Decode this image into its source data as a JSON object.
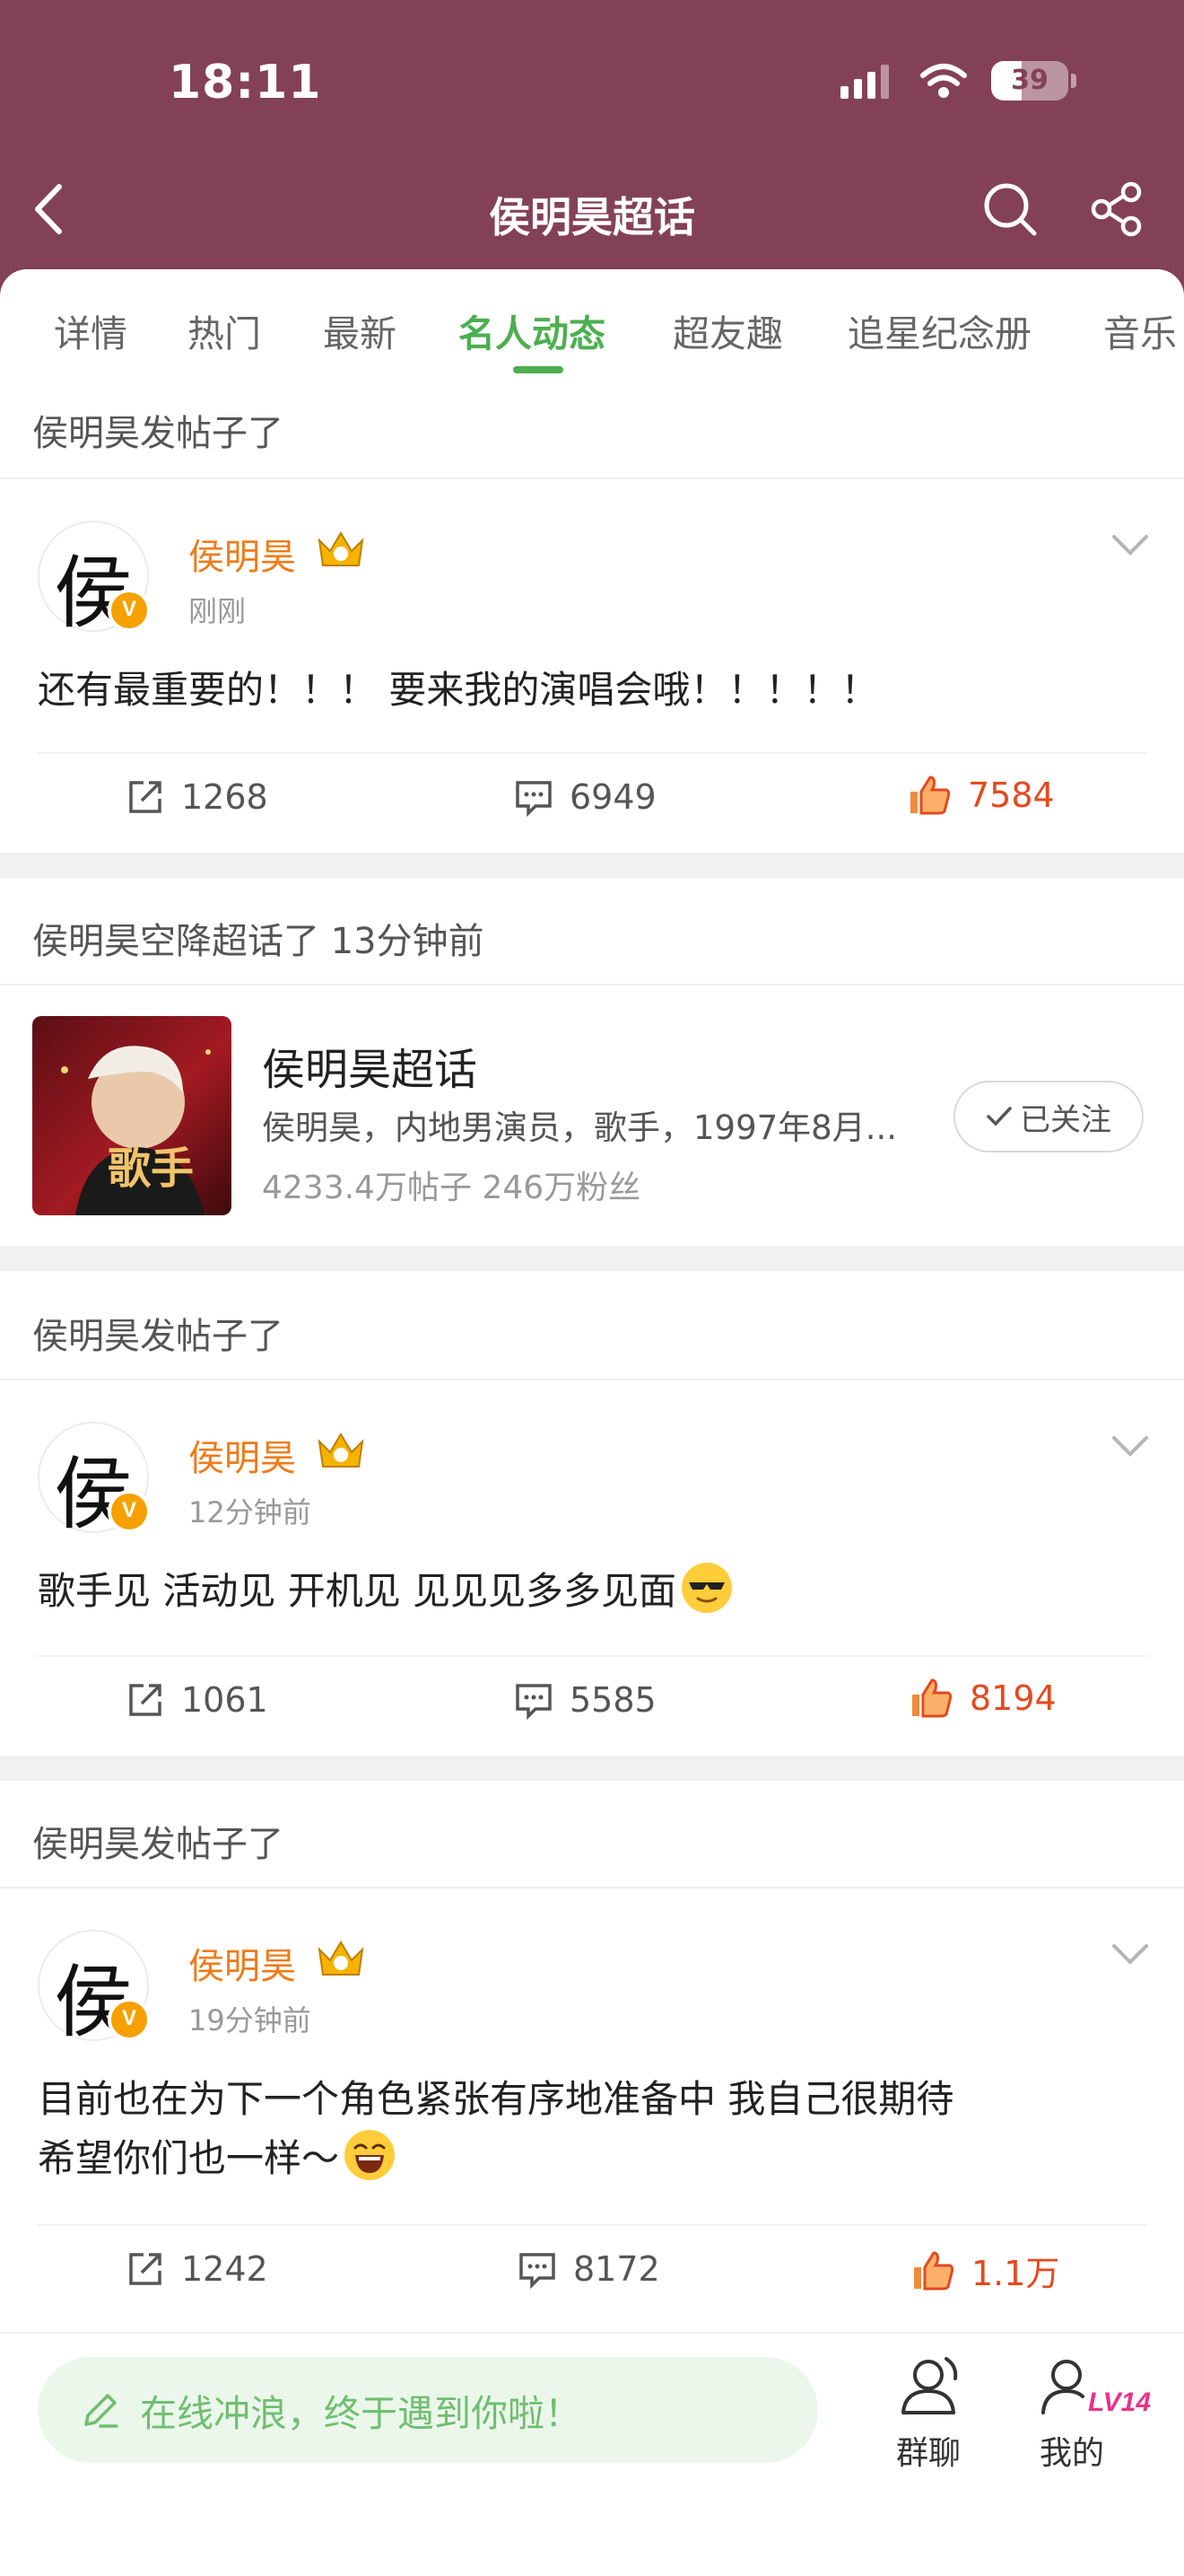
{
  "status_bar": {
    "time": "18:11",
    "battery": "39",
    "battery_level": 0.39
  },
  "nav": {
    "title": "侯明昊超话"
  },
  "tabs": [
    {
      "label": "详情"
    },
    {
      "label": "热门"
    },
    {
      "label": "最新"
    },
    {
      "label": "名人动态"
    },
    {
      "label": "超友趣"
    },
    {
      "label": "追星纪念册"
    },
    {
      "label": "音乐"
    }
  ],
  "active_tab": "名人动态",
  "feed": {
    "post1": {
      "header": "侯明昊发帖子了",
      "avatar_char": "侯",
      "badge": "V",
      "user": "侯明昊",
      "time": "刚刚",
      "text": "还有最重要的！！！ 要来我的演唱会哦！！！！！",
      "reposts": "1268",
      "comments": "6949",
      "likes": "7584"
    },
    "topic": {
      "header": "侯明昊空降超话了 13分钟前",
      "thumb_text": "歌手",
      "name": "侯明昊超话",
      "desc": "侯明昊，内地男演员，歌手，1997年8月...",
      "stats": "4233.4万帖子  246万粉丝",
      "follow_label": "已关注"
    },
    "post2": {
      "header": "侯明昊发帖子了",
      "avatar_char": "侯",
      "badge": "V",
      "user": "侯明昊",
      "time": "12分钟前",
      "text": "歌手见  活动见  开机见  见见见多多见面",
      "emoji": "cool-face-emoji",
      "reposts": "1061",
      "comments": "5585",
      "likes": "8194"
    },
    "post3": {
      "header": "侯明昊发帖子了",
      "avatar_char": "侯",
      "badge": "V",
      "user": "侯明昊",
      "time": "19分钟前",
      "text_line1": "目前也在为下一个角色紧张有序地准备中  我自己很期待",
      "text_line2": "希望你们也一样～",
      "emoji": "laughing-face-emoji",
      "reposts": "1242",
      "comments": "8172",
      "likes": "1.1万"
    }
  },
  "bottom_bar": {
    "compose_placeholder": "在线冲浪，终于遇到你啦！",
    "group_chat_label": "群聊",
    "me_label": "我的",
    "level_badge": "LV14"
  },
  "colors": {
    "header_bg": "#834157",
    "accent_green": "#4caf50",
    "username_orange": "#f07b19",
    "like_red": "#e5491e",
    "level_pink": "#e8338a"
  }
}
